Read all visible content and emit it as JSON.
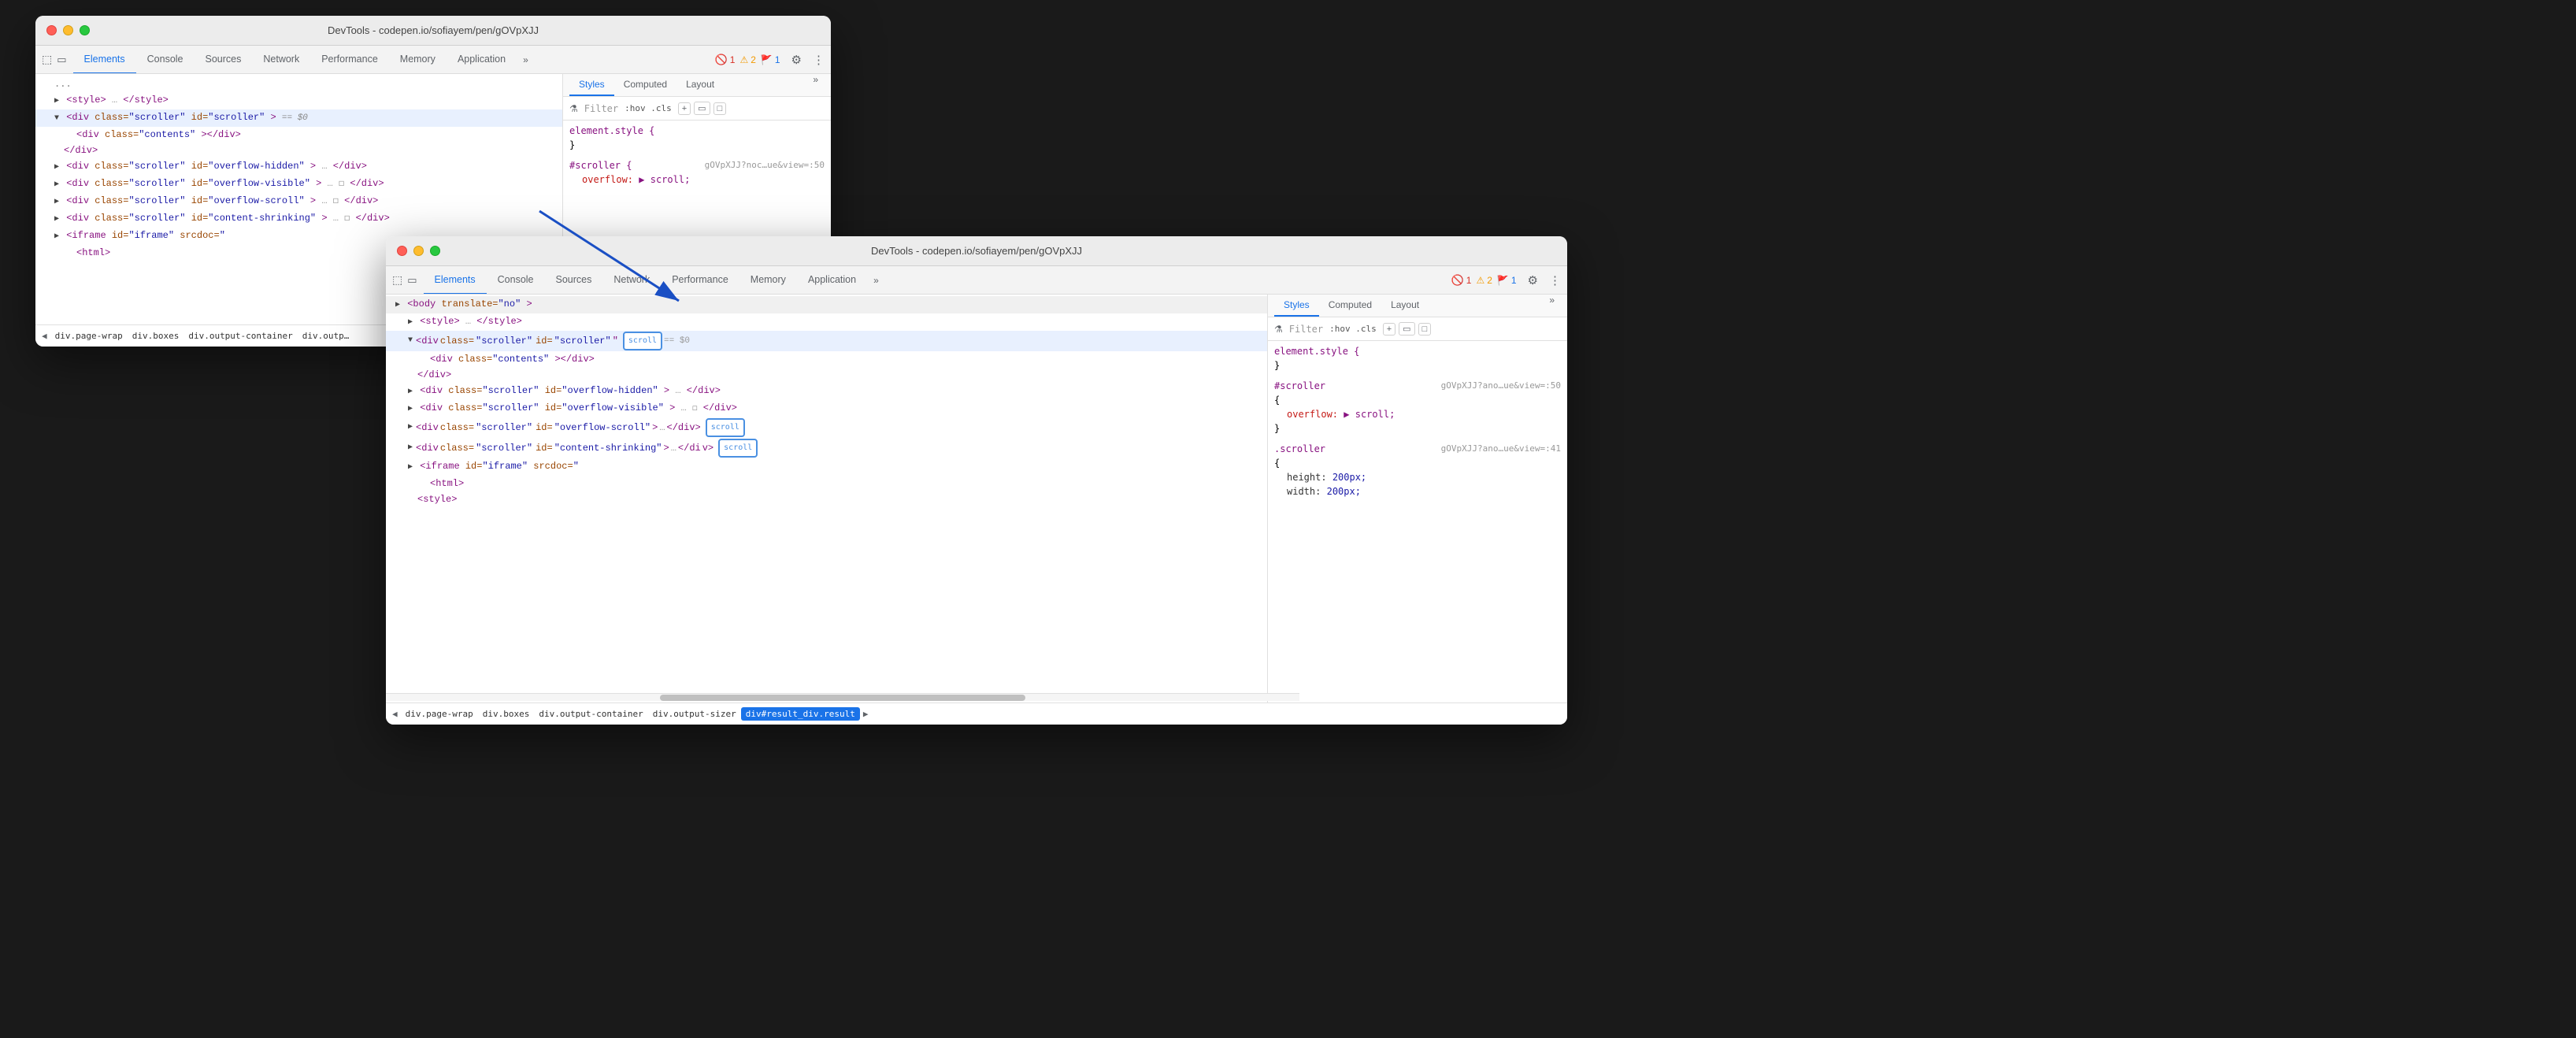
{
  "window1": {
    "title": "DevTools - codepen.io/sofiayem/pen/gOVpXJJ",
    "tabs": [
      "Elements",
      "Console",
      "Sources",
      "Network",
      "Performance",
      "Memory",
      "Application"
    ],
    "active_tab": "Elements",
    "errors": {
      "red": "1",
      "yellow": "2",
      "blue": "1"
    },
    "styles_tabs": [
      "Styles",
      "Computed",
      "Layout"
    ],
    "active_styles_tab": "Styles",
    "filter_placeholder": ":hov .cls",
    "breadcrumb": [
      "div.page-wrap",
      "div.boxes",
      "div.output-container",
      "div.outp…"
    ]
  },
  "window2": {
    "title": "DevTools - codepen.io/sofiayem/pen/gOVpXJJ",
    "tabs": [
      "Elements",
      "Console",
      "Sources",
      "Network",
      "Performance",
      "Memory",
      "Application"
    ],
    "active_tab": "Elements",
    "errors": {
      "red": "1",
      "yellow": "2",
      "blue": "1"
    },
    "styles_tabs": [
      "Styles",
      "Computed",
      "Layout"
    ],
    "active_styles_tab": "Styles",
    "filter_placeholder": ":hov .cls",
    "breadcrumb": [
      "div.page-wrap",
      "div.boxes",
      "div.output-container",
      "div.output-sizer",
      "div#result_div.result"
    ]
  },
  "css": {
    "element_style": "element.style {",
    "element_style_close": "}",
    "scroller_selector": "#scroller",
    "scroller_url1": "gOVpXJJ?noc…ue&view=:50",
    "scroller_property": "overflow:",
    "scroller_value": "▶ scroll;",
    "scroller_selector2": ".scroller",
    "scroller_url2": "gOVpXJJ?ano…ue&view=:41",
    "scroller2_property1": "height:",
    "scroller2_value1": "200px;",
    "scroller2_property2": "width:",
    "scroller2_value2": "200px;"
  },
  "html_tree": {
    "lines": [
      {
        "text": "<style> … </style>",
        "indent": 1,
        "selected": false
      },
      {
        "text": "<div class=\"scroller\" id=\"scroller\"> == $0",
        "indent": 1,
        "selected": true,
        "has_triangle": true
      },
      {
        "text": "<div class=\"contents\"></div>",
        "indent": 2,
        "selected": false
      },
      {
        "text": "</div>",
        "indent": 2,
        "selected": false
      },
      {
        "text": "<div class=\"scroller\" id=\"overflow-hidden\"> … </div>",
        "indent": 1,
        "selected": false,
        "has_triangle": true
      },
      {
        "text": "<div class=\"scroller\" id=\"overflow-visible\"> … </div>",
        "indent": 1,
        "selected": false,
        "has_triangle": true
      },
      {
        "text": "<div class=\"scroller\" id=\"overflow-scroll\"> … </div>",
        "indent": 1,
        "selected": false,
        "has_triangle": true
      },
      {
        "text": "<div class=\"scroller\" id=\"content-shrinking\"> … </div>",
        "indent": 1,
        "selected": false,
        "has_triangle": true
      },
      {
        "text": "<iframe id=\"iframe\" srcdoc=\"",
        "indent": 1,
        "selected": false,
        "has_triangle": true
      },
      {
        "text": "<html>",
        "indent": 2,
        "selected": false
      }
    ]
  }
}
